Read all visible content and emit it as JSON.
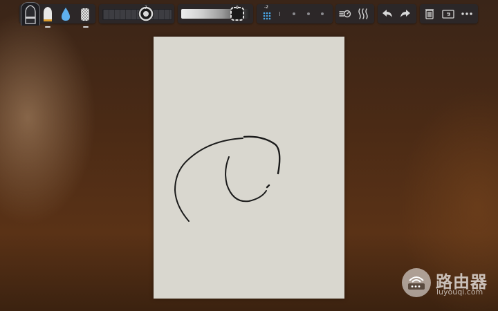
{
  "toolbar": {
    "tools": [
      {
        "name": "marker",
        "selected": true
      },
      {
        "name": "eraser",
        "selected": false
      },
      {
        "name": "water-drop",
        "selected": false
      },
      {
        "name": "texture",
        "selected": false
      }
    ],
    "brush_size": {
      "value": "7"
    },
    "brush_opacity": {
      "value": "9"
    },
    "dot_grid": {
      "value": "-2"
    }
  },
  "watermark": {
    "title": "路由器",
    "subtitle": "luyouqi.com"
  },
  "colors": {
    "toolbar_bg": "#28282c",
    "paper": "#d9d7cf",
    "ink": "#1a1a1a",
    "accent_blue": "#4aa8e8"
  }
}
